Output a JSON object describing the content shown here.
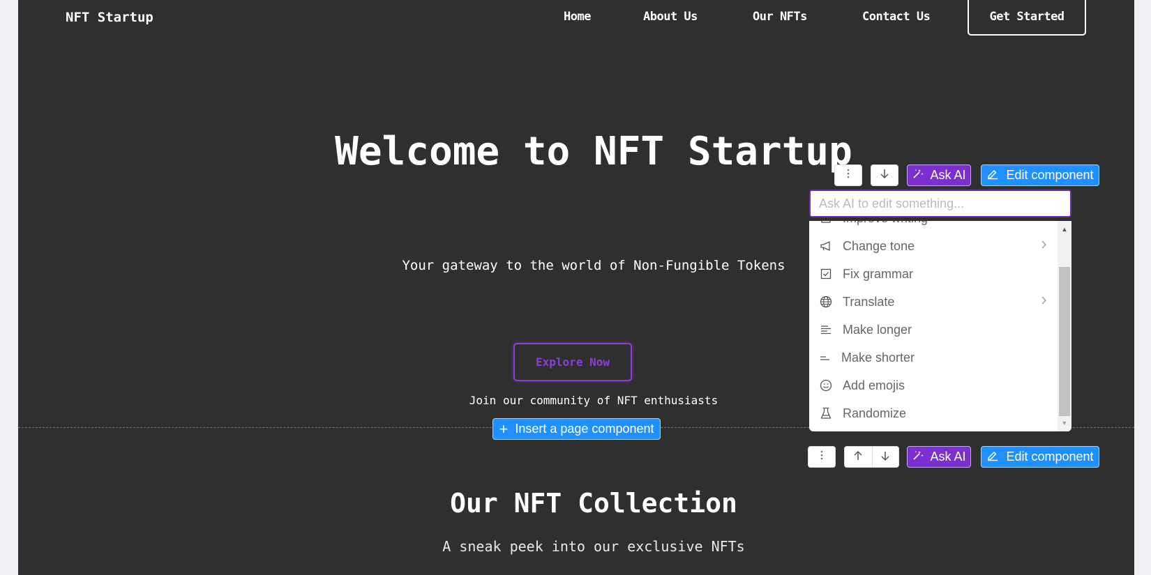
{
  "header": {
    "brand": "NFT Startup",
    "nav": [
      {
        "label": "Home"
      },
      {
        "label": "About Us"
      },
      {
        "label": "Our NFTs"
      },
      {
        "label": "Contact Us"
      }
    ],
    "cta": "Get Started"
  },
  "hero": {
    "title": "Welcome to NFT Startup",
    "subtitle": "Your gateway to the world of Non-Fungible Tokens",
    "button": "Explore Now",
    "tagline": "Join our community of NFT enthusiasts"
  },
  "insert_component": {
    "label": "Insert a page component",
    "icon": "plus-icon"
  },
  "collection": {
    "title": "Our NFT Collection",
    "subtitle": "A sneak peek into our exclusive NFTs"
  },
  "editor": {
    "toolbar_top": {
      "more_icon": "more-vertical-icon",
      "down_icon": "arrow-down-icon",
      "ask_ai": "Ask AI",
      "edit": "Edit component"
    },
    "toolbar_bottom": {
      "more_icon": "more-vertical-icon",
      "up_icon": "arrow-up-icon",
      "down_icon": "arrow-down-icon",
      "ask_ai": "Ask AI",
      "edit": "Edit component"
    },
    "ai_input": {
      "value": "",
      "placeholder": "Ask AI to edit something..."
    },
    "menu": {
      "items": [
        {
          "label": "Improve writing",
          "icon": "pencil-square-icon",
          "submenu": false
        },
        {
          "label": "Change tone",
          "icon": "megaphone-icon",
          "submenu": true
        },
        {
          "label": "Fix grammar",
          "icon": "checkbox-icon",
          "submenu": false
        },
        {
          "label": "Translate",
          "icon": "globe-icon",
          "submenu": true
        },
        {
          "label": "Make longer",
          "icon": "align-left-icon",
          "submenu": false
        },
        {
          "label": "Make shorter",
          "icon": "short-lines-icon",
          "submenu": false
        },
        {
          "label": "Add emojis",
          "icon": "smiley-icon",
          "submenu": false
        },
        {
          "label": "Randomize",
          "icon": "flask-icon",
          "submenu": false
        }
      ],
      "scroll_position": 0.22
    }
  },
  "colors": {
    "page_bg": "#2f2f2f",
    "outer_bg": "#f0f1f4",
    "accent_purple": "#7b2fd0",
    "explore_purple": "#8a3fd9",
    "editor_blue": "#1e90ff"
  }
}
